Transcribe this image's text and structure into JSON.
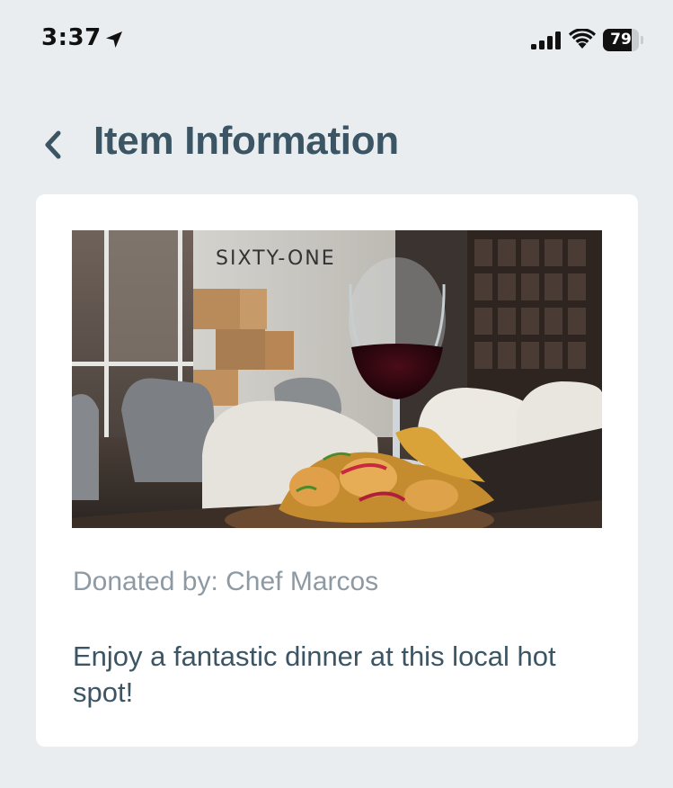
{
  "status_bar": {
    "time": "3:37",
    "battery_level": "79",
    "battery_fraction": 0.79,
    "icons": [
      "location-arrow-icon",
      "cellular-signal-icon",
      "wifi-icon",
      "battery-icon"
    ]
  },
  "header": {
    "back_icon": "chevron-left-icon",
    "title": "Item Information"
  },
  "item": {
    "photo_sign_text": "SIXTY-ONE",
    "donated_by_label": "Donated by:",
    "donor_name": "Chef Marcos",
    "description": "Enjoy a fantastic dinner at this local hot spot!"
  },
  "colors": {
    "background": "#e9edef",
    "card": "#ffffff",
    "title_text": "#3b5565",
    "secondary_text": "#8e9aa3"
  }
}
